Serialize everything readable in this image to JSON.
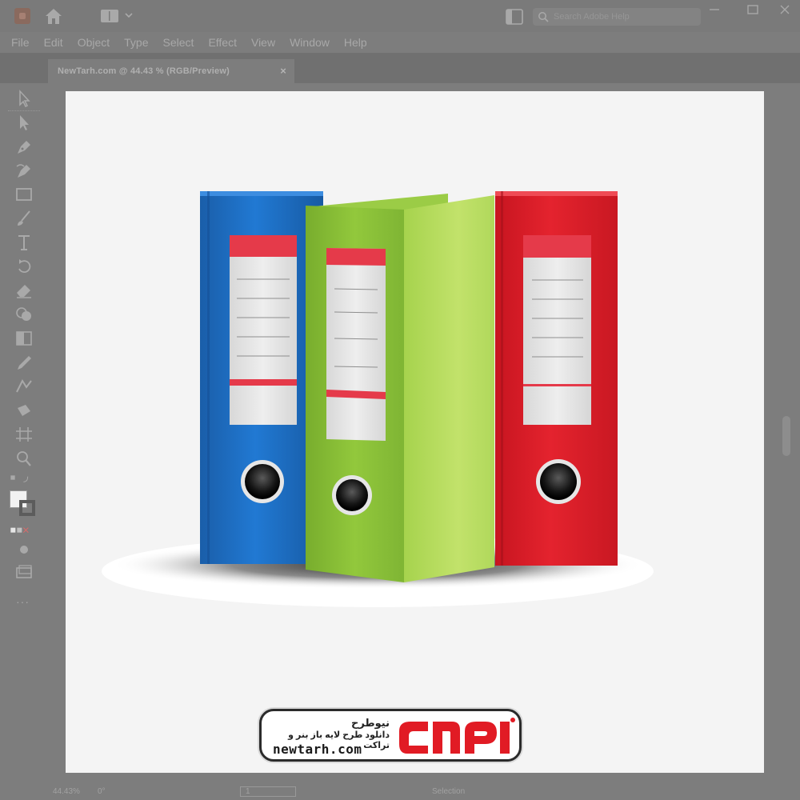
{
  "window": {
    "tab_title": "NewTarh.com @ 44.43 % (RGB/Preview)",
    "tab_close": "×"
  },
  "search": {
    "placeholder": "Search Adobe Help"
  },
  "menu": [
    "File",
    "Edit",
    "Object",
    "Type",
    "Select",
    "Effect",
    "View",
    "Window",
    "Help"
  ],
  "toolbar": {
    "tools": [
      "selection-tool-icon",
      "direct-selection-tool-icon",
      "pen-tool-icon",
      "curvature-tool-icon",
      "rectangle-tool-icon",
      "paintbrush-tool-icon",
      "type-tool-icon",
      "rotate-tool-icon",
      "eraser-tool-icon",
      "shape-builder-tool-icon",
      "gradient-tool-icon",
      "eyedropper-tool-icon",
      "blend-tool-icon",
      "symbol-sprayer-tool-icon",
      "artboard-tool-icon",
      "zoom-tool-icon"
    ],
    "more": "···"
  },
  "artwork": {
    "binders": [
      {
        "name": "blue-binder",
        "color": "#1f6fc6"
      },
      {
        "name": "green-binder",
        "color": "#8cc63e"
      },
      {
        "name": "red-binder",
        "color": "#e0222c"
      }
    ],
    "label_accent": "#e53a4a"
  },
  "watermark": {
    "brand_fa": "نیوطرح",
    "tagline_fa": "دانلود طرح لایه باز بنر و تراکت",
    "site": "newtarh.com",
    "logo_mark": "نیوطرح",
    "logo_color": "#e11b24"
  },
  "status": {
    "zoom": "44.43%",
    "angle": "0°",
    "page": "1",
    "mode": "Selection"
  }
}
